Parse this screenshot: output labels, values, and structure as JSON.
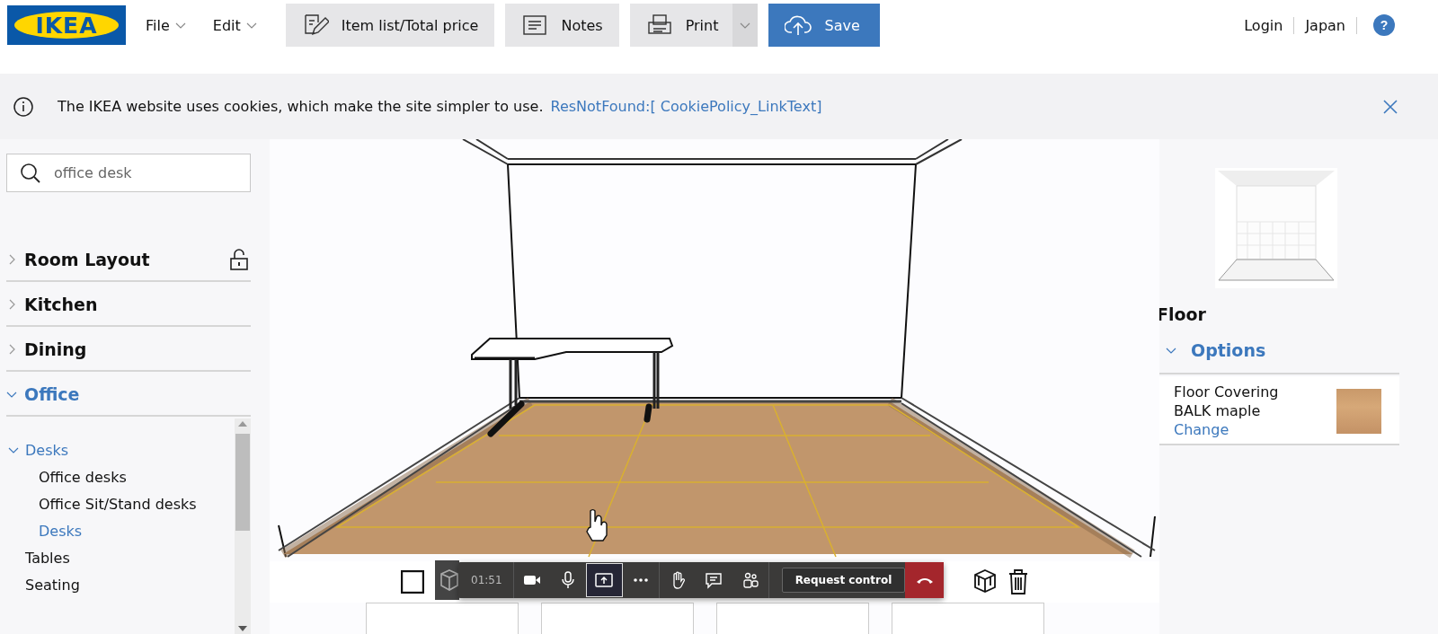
{
  "header": {
    "logo": "IKEA",
    "menus": [
      {
        "label": "File"
      },
      {
        "label": "Edit"
      }
    ],
    "buttons": [
      {
        "kind": "list",
        "label": "Item list/Total price"
      },
      {
        "kind": "notes",
        "label": "Notes"
      },
      {
        "kind": "print",
        "label": "Print"
      },
      {
        "kind": "save",
        "label": "Save"
      }
    ],
    "links": [
      "Login",
      "Japan"
    ],
    "help": "?"
  },
  "cookie_banner": {
    "text": "The IKEA website uses cookies, which make the site simpler to use.",
    "link": "ResNotFound:[ CookiePolicy_LinkText]"
  },
  "search": {
    "value": "office desk"
  },
  "categories": [
    {
      "label": "Room Layout",
      "expanded": false,
      "lock": true
    },
    {
      "label": "Kitchen",
      "expanded": false,
      "lock": false
    },
    {
      "label": "Dining",
      "expanded": false,
      "lock": false
    },
    {
      "label": "Office",
      "expanded": true,
      "lock": false
    }
  ],
  "subcategories": [
    {
      "label": "Desks",
      "expanded": true,
      "children": [
        {
          "label": "Office desks",
          "selected": false
        },
        {
          "label": "Office Sit/Stand desks",
          "selected": false
        },
        {
          "label": "Desks",
          "selected": true
        }
      ]
    },
    {
      "label": "Tables",
      "expanded": false
    },
    {
      "label": "Seating",
      "expanded": false
    }
  ],
  "right_panel": {
    "title": "Floor",
    "section": "Options",
    "expanded": true,
    "option": {
      "name": "Floor Covering",
      "value": "BALK maple",
      "action": "Change"
    }
  },
  "call_bar": {
    "timer": "01:51",
    "sharing": true,
    "request_button": "Request control"
  }
}
